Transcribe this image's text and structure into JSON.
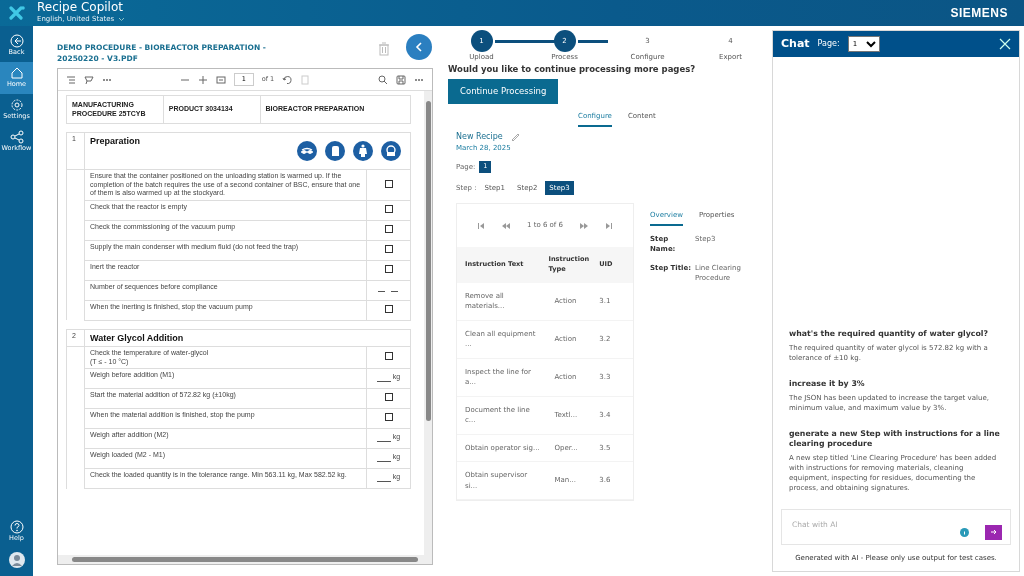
{
  "app": {
    "title": "Recipe Copilot",
    "language": "English, United States",
    "brand": "SIEMENS"
  },
  "nav": [
    {
      "label": "Back",
      "kind": "back",
      "selected": false
    },
    {
      "label": "Home",
      "kind": "home",
      "selected": true
    },
    {
      "label": "Settings",
      "kind": "settings",
      "selected": false
    },
    {
      "label": "Workflow",
      "kind": "workflow",
      "selected": false
    }
  ],
  "help": {
    "label": "Help"
  },
  "document": {
    "title": "DEMO PROCEDURE - BIOREACTOR PREPARATION - 20250220 - V3.PDF",
    "toolbar": {
      "page": "1",
      "page_count": "of 1"
    },
    "header_cells": [
      "MANUFACTURING PROCEDURE 25TCYB",
      "PRODUCT 3034134",
      "BIOREACTOR PREPARATION"
    ],
    "sections": [
      {
        "number": "1",
        "title": "Preparation",
        "safety_icons": true,
        "rows": [
          {
            "text": "Ensure that the container positioned on the unloading station is warmed up. If the completion of the batch requires the use of a second container of BSC, ensure that one of them is also warmed up at the stockyard.",
            "kind": "checkbox",
            "checked": false
          },
          {
            "text": "Check that the reactor is empty",
            "kind": "checkbox",
            "checked": false
          },
          {
            "text": "Check the commissioning of the vacuum pump",
            "kind": "checkbox",
            "checked": false
          },
          {
            "text": "Supply the main condenser with medium fluid (do not feed the trap)",
            "kind": "checkbox",
            "checked": false
          },
          {
            "text": "Inert the reactor",
            "kind": "checkbox",
            "checked": false
          },
          {
            "text": "Number of sequences before compliance",
            "kind": "count"
          },
          {
            "text": "When the inerting is finished, stop the vacuum pump",
            "kind": "checkbox",
            "checked": false
          }
        ]
      },
      {
        "number": "2",
        "title": "Water Glycol Addition",
        "safety_icons": false,
        "rows": [
          {
            "text": "Check the temperature of water-glycol\n(T ≤ - 10 °C)",
            "kind": "checkbox",
            "checked": false
          },
          {
            "text": "Weigh before addition (M1)",
            "kind": "weight",
            "unit": "kg"
          },
          {
            "text": "Start the material addition of 572.82 kg (±10kg)",
            "kind": "checkbox",
            "checked": false
          },
          {
            "text": "When the material addition is finished, stop the pump",
            "kind": "checkbox",
            "checked": false
          },
          {
            "text": "Weigh after addition (M2)",
            "kind": "weight",
            "unit": "kg"
          },
          {
            "text": "Weigh loaded (M2 - M1)",
            "kind": "weight",
            "unit": "kg"
          },
          {
            "text": "Check the loaded quantity is in the tolerance range. Min 563.11 kg, Max 582.52 kg.",
            "kind": "weight",
            "unit": "kg"
          }
        ]
      }
    ]
  },
  "stepper": [
    {
      "number": "1",
      "label": "Upload",
      "completed": true
    },
    {
      "number": "2",
      "label": "Process",
      "completed": true
    },
    {
      "number": "3",
      "label": "Configure",
      "completed": false
    },
    {
      "number": "4",
      "label": "Export",
      "completed": false
    }
  ],
  "question": "Would you like to continue processing more pages?",
  "continue_button": "Continue Processing",
  "tabs": [
    {
      "label": "Configure",
      "selected": true
    },
    {
      "label": "Content",
      "selected": false
    }
  ],
  "recipe": {
    "name": "New Recipe",
    "date": "March 28, 2025",
    "page_label": "Page:",
    "page": "1",
    "step_label": "Step :"
  },
  "steps": [
    {
      "label": "Step1",
      "selected": false
    },
    {
      "label": "Step2",
      "selected": false
    },
    {
      "label": "Step3",
      "selected": true
    }
  ],
  "table": {
    "pager": "1 to 6 of 6",
    "columns": [
      "Instruction Text",
      "Instruction Type",
      "UID"
    ],
    "rows": [
      [
        "Remove all materials...",
        "Action",
        "3.1"
      ],
      [
        "Clean all equipment ...",
        "Action",
        "3.2"
      ],
      [
        "Inspect the line for a...",
        "Action",
        "3.3"
      ],
      [
        "Document the line c...",
        "Textl...",
        "3.4"
      ],
      [
        "Obtain operator sig...",
        "Oper...",
        "3.5"
      ],
      [
        "Obtain supervisor si...",
        "Man...",
        "3.6"
      ]
    ]
  },
  "detail_tabs": [
    {
      "label": "Overview",
      "selected": true
    },
    {
      "label": "Properties",
      "selected": false
    }
  ],
  "details": [
    {
      "label": "Step Name:",
      "value": "Step3"
    },
    {
      "label": "Step Title:",
      "value": "Line Clearing Procedure"
    }
  ],
  "chat": {
    "title": "Chat",
    "page_label": "Page:",
    "page": "1",
    "messages": [
      {
        "question": "what's the required quantity of water glycol?",
        "answer": "The required quantity of water glycol is 572.82 kg with a tolerance of ±10 kg."
      },
      {
        "question": "increase it by 3%",
        "answer": "The JSON has been updated to increase the target value, minimum value, and maximum value by 3%."
      },
      {
        "question": "generate a new Step with instructions for a line clearing procedure",
        "answer": "A new step titled 'Line Clearing Procedure' has been added with instructions for removing materials, cleaning equipment, inspecting for residues, documenting the process, and obtaining signatures."
      }
    ],
    "placeholder": "Chat with AI",
    "footer": "Generated with AI - Please only use output for test cases."
  }
}
